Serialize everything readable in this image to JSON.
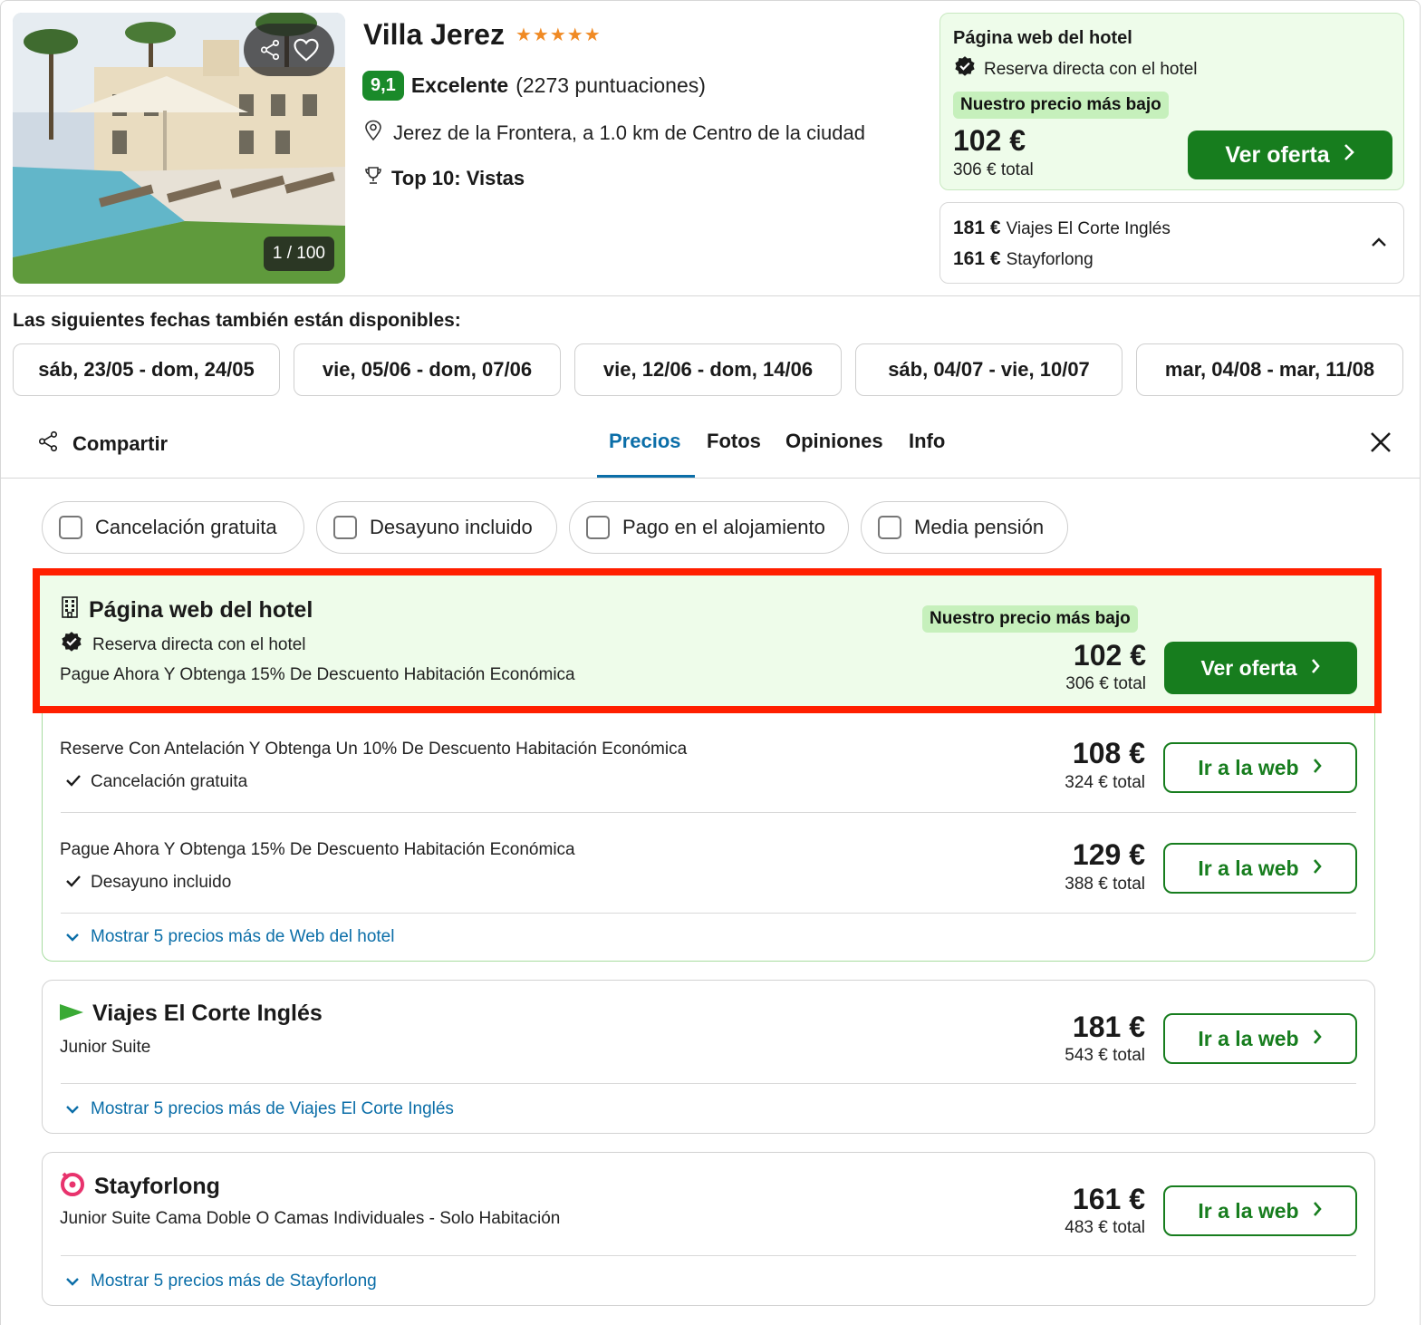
{
  "hotel": {
    "name": "Villa Jerez",
    "stars": "★★★★★",
    "rating_score": "9,1",
    "rating_label": "Excelente",
    "rating_count": "(2273 puntuaciones)",
    "location": "Jerez de la Frontera, a 1.0 km de Centro de la ciudad",
    "award": "Top 10: Vistas",
    "photo_counter": "1 / 100"
  },
  "top_offer": {
    "provider": "Página web del hotel",
    "direct_label": "Reserva directa con el hotel",
    "lowest_tag": "Nuestro precio más bajo",
    "price": "102 €",
    "total": "306 € total",
    "button": "Ver oferta"
  },
  "other_offers": [
    {
      "price": "181 €",
      "provider": "Viajes El Corte Inglés"
    },
    {
      "price": "161 €",
      "provider": "Stayforlong"
    }
  ],
  "dates": {
    "title": "Las siguientes fechas también están disponibles:",
    "chips": [
      "sáb, 23/05 - dom, 24/05",
      "vie, 05/06 - dom, 07/06",
      "vie, 12/06 - dom, 14/06",
      "sáb, 04/07 - vie, 10/07",
      "mar, 04/08 - mar, 11/08"
    ]
  },
  "tabs": {
    "share": "Compartir",
    "items": [
      "Precios",
      "Fotos",
      "Opiniones",
      "Info"
    ]
  },
  "filters": [
    "Cancelación gratuita",
    "Desayuno incluido",
    "Pago en el alojamiento",
    "Media pensión"
  ],
  "hotel_site_group": {
    "featured": {
      "provider": "Página web del hotel",
      "direct_label": "Reserva directa con el hotel",
      "description": "Pague Ahora Y Obtenga 15% De Descuento Habitación Económica",
      "lowest_tag": "Nuestro precio más bajo",
      "price": "102 €",
      "total": "306 € total",
      "button": "Ver oferta"
    },
    "rows": [
      {
        "description": "Reserve Con Antelación Y Obtenga Un 10% De Descuento Habitación Económica",
        "feature": "Cancelación gratuita",
        "price": "108 €",
        "total": "324 € total",
        "button": "Ir a la web"
      },
      {
        "description": "Pague Ahora Y Obtenga 15% De Descuento Habitación Económica",
        "feature": "Desayuno incluido",
        "price": "129 €",
        "total": "388 € total",
        "button": "Ir a la web"
      }
    ],
    "more_link": "Mostrar 5 precios más de Web del hotel"
  },
  "corte_ingles_group": {
    "provider": "Viajes El Corte Inglés",
    "description": "Junior Suite",
    "price": "181 €",
    "total": "543 € total",
    "button": "Ir a la web",
    "more_link": "Mostrar 5 precios más de Viajes El Corte Inglés"
  },
  "stayforlong_group": {
    "provider": "Stayforlong",
    "description": "Junior Suite Cama Doble O Camas Individuales - Solo Habitación",
    "price": "161 €",
    "total": "483 € total",
    "button": "Ir a la web",
    "more_link": "Mostrar 5 precios más de Stayforlong"
  },
  "colors": {
    "brand_green": "#177d1e",
    "rating_green": "#1a8a2a",
    "accent_blue": "#0b6ea8",
    "highlight_red": "#ff1f00",
    "offer_bg": "#eefcea",
    "star_orange": "#f08a24"
  }
}
